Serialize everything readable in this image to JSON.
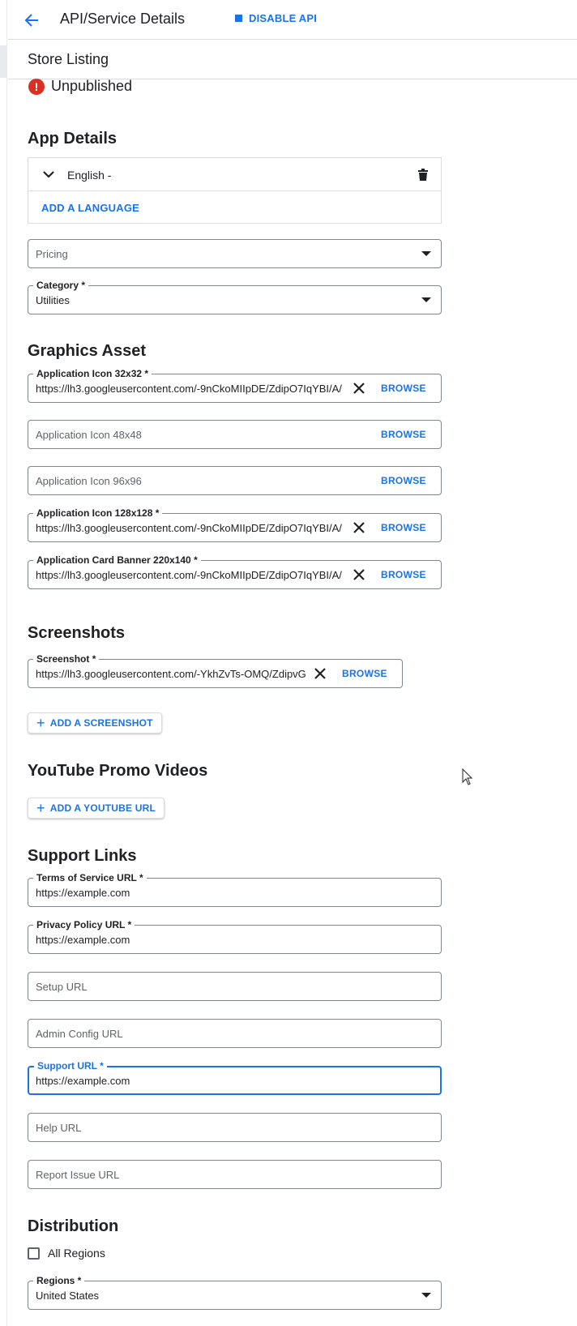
{
  "header": {
    "title": "API/Service Details",
    "disable_label": "DISABLE API",
    "accent": "#1a73e8"
  },
  "subheader": {
    "title": "Store Listing"
  },
  "status": {
    "icon": "error-icon",
    "text": "Unpublished",
    "color": "#d93025"
  },
  "app_details": {
    "title": "App Details",
    "language": "English -",
    "add_language": "ADD A LANGUAGE",
    "pricing": {
      "placeholder": "Pricing"
    },
    "category": {
      "label": "Category *",
      "value": "Utilities"
    }
  },
  "graphics": {
    "title": "Graphics Asset",
    "browse": "BROWSE",
    "icon32": {
      "label": "Application Icon 32x32 *",
      "value": "https://lh3.googleusercontent.com/-9nCkoMIIpDE/ZdipO7IqYBI/A/"
    },
    "icon48": {
      "placeholder": "Application Icon 48x48"
    },
    "icon96": {
      "placeholder": "Application Icon 96x96"
    },
    "icon128": {
      "label": "Application Icon 128x128 *",
      "value": "https://lh3.googleusercontent.com/-9nCkoMIIpDE/ZdipO7IqYBI/A/"
    },
    "banner": {
      "label": "Application Card Banner 220x140 *",
      "value": "https://lh3.googleusercontent.com/-9nCkoMIIpDE/ZdipO7IqYBI/A/"
    }
  },
  "screenshots": {
    "title": "Screenshots",
    "field": {
      "label": "Screenshot *",
      "value": "https://lh3.googleusercontent.com/-YkhZvTs-OMQ/ZdipvG"
    },
    "add": "ADD A SCREENSHOT"
  },
  "youtube": {
    "title": "YouTube Promo Videos",
    "add": "ADD A YOUTUBE URL"
  },
  "support": {
    "title": "Support Links",
    "terms": {
      "label": "Terms of Service URL *",
      "value": "https://example.com"
    },
    "privacy": {
      "label": "Privacy Policy URL *",
      "value": "https://example.com"
    },
    "setup": {
      "placeholder": "Setup URL"
    },
    "admin": {
      "placeholder": "Admin Config URL"
    },
    "support_url": {
      "label": "Support URL *",
      "value": "https://example.com"
    },
    "help": {
      "placeholder": "Help URL"
    },
    "report": {
      "placeholder": "Report Issue URL"
    }
  },
  "distribution": {
    "title": "Distribution",
    "all_regions": "All Regions",
    "regions": {
      "label": "Regions *",
      "value": "United States"
    }
  }
}
